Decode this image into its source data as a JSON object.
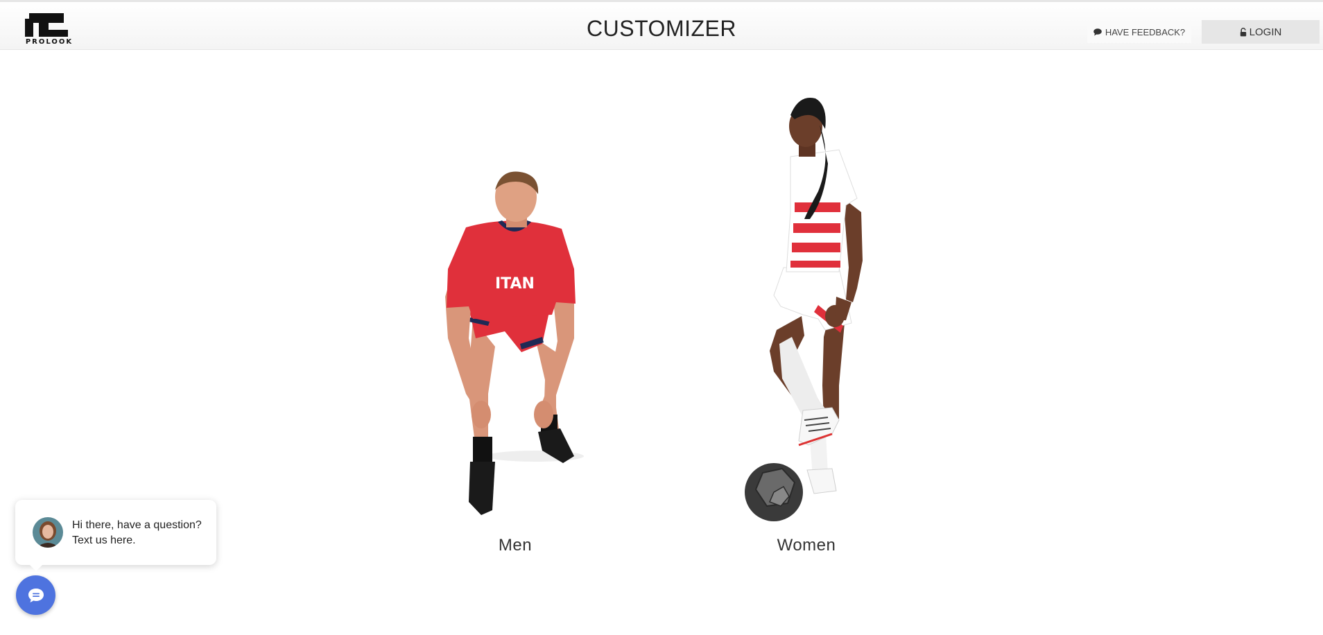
{
  "header": {
    "logo_text": "PROLOOK",
    "title": "CUSTOMIZER",
    "feedback_label": "HAVE FEEDBACK?",
    "login_label": "LOGIN"
  },
  "categories": [
    {
      "label": "Men"
    },
    {
      "label": "Women"
    }
  ],
  "chat": {
    "message": "Hi there, have a question? Text us here."
  },
  "colors": {
    "launcher": "#4e73df",
    "jersey_red": "#e0303b"
  },
  "icons": {
    "feedback": "speech-bubble-icon",
    "login": "unlock-icon",
    "launcher": "chat-icon"
  }
}
